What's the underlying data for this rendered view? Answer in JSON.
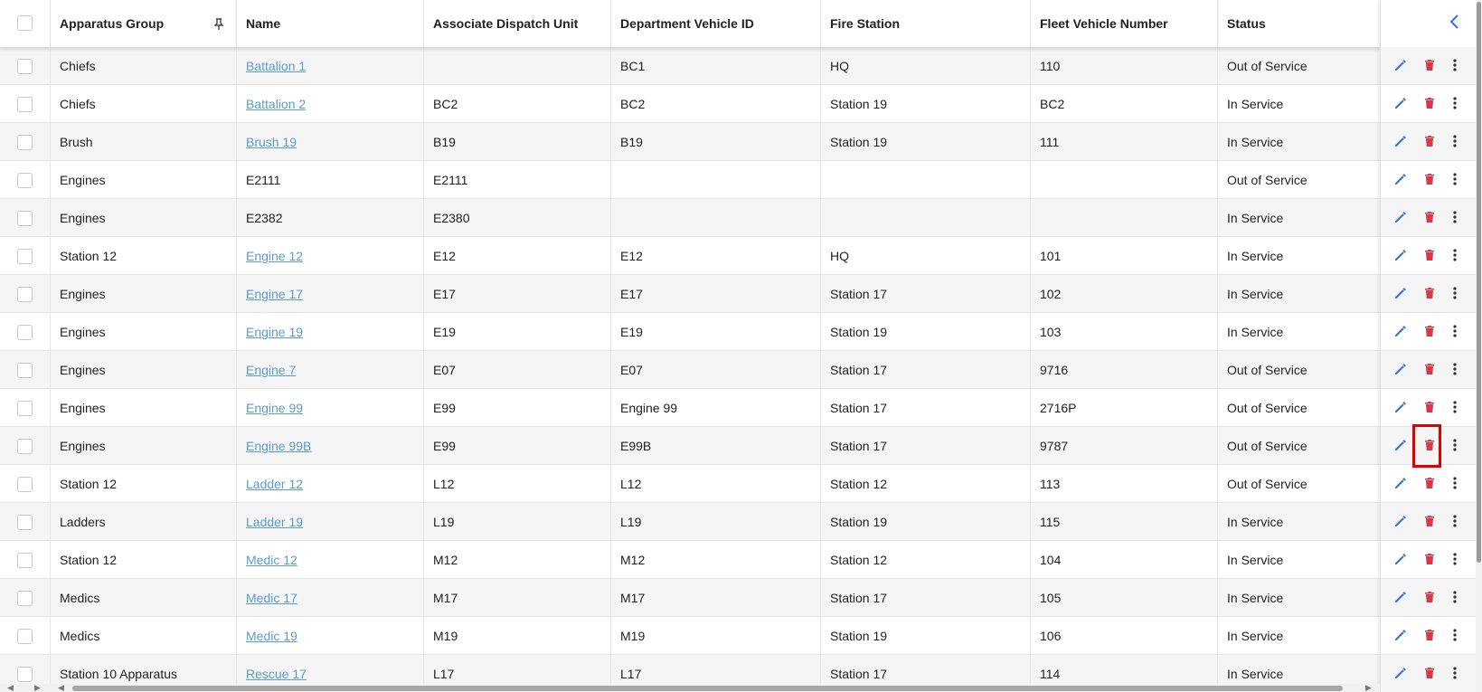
{
  "columns": [
    "Apparatus Group",
    "Name",
    "Associate Dispatch Unit",
    "Department Vehicle ID",
    "Fire Station",
    "Fleet Vehicle Number",
    "Status"
  ],
  "pin_icon": "pin-icon",
  "collapse_icon": "chevron-left-icon",
  "rows": [
    {
      "group": "Chiefs",
      "name": "Battalion 1",
      "link": true,
      "adu": "",
      "dvid": "BC1",
      "station": "HQ",
      "fleet": "110",
      "status": "Out of Service"
    },
    {
      "group": "Chiefs",
      "name": "Battalion 2",
      "link": true,
      "adu": "BC2",
      "dvid": "BC2",
      "station": "Station 19",
      "fleet": "BC2",
      "status": "In Service"
    },
    {
      "group": "Brush",
      "name": "Brush 19",
      "link": true,
      "adu": "B19",
      "dvid": "B19",
      "station": "Station 19",
      "fleet": "111",
      "status": "In Service"
    },
    {
      "group": "Engines",
      "name": "E2111",
      "link": false,
      "adu": "E2111",
      "dvid": "",
      "station": "",
      "fleet": "",
      "status": "Out of Service"
    },
    {
      "group": "Engines",
      "name": "E2382",
      "link": false,
      "adu": "E2380",
      "dvid": "",
      "station": "",
      "fleet": "",
      "status": "In Service"
    },
    {
      "group": "Station 12",
      "name": "Engine 12",
      "link": true,
      "adu": "E12",
      "dvid": "E12",
      "station": "HQ",
      "fleet": "101",
      "status": "In Service"
    },
    {
      "group": "Engines",
      "name": "Engine 17",
      "link": true,
      "adu": "E17",
      "dvid": "E17",
      "station": "Station 17",
      "fleet": "102",
      "status": "In Service"
    },
    {
      "group": "Engines",
      "name": "Engine 19",
      "link": true,
      "adu": "E19",
      "dvid": "E19",
      "station": "Station 19",
      "fleet": "103",
      "status": "In Service"
    },
    {
      "group": "Engines",
      "name": "Engine 7",
      "link": true,
      "adu": "E07",
      "dvid": "E07",
      "station": "Station 17",
      "fleet": "9716",
      "status": "Out of Service"
    },
    {
      "group": "Engines",
      "name": "Engine 99",
      "link": true,
      "adu": "E99",
      "dvid": "Engine 99",
      "station": "Station 17",
      "fleet": "2716P",
      "status": "Out of Service"
    },
    {
      "group": "Engines",
      "name": "Engine 99B",
      "link": true,
      "adu": "E99",
      "dvid": "E99B",
      "station": "Station 17",
      "fleet": "9787",
      "status": "Out of Service"
    },
    {
      "group": "Station 12",
      "name": "Ladder 12",
      "link": true,
      "adu": "L12",
      "dvid": "L12",
      "station": "Station 12",
      "fleet": "113",
      "status": "Out of Service"
    },
    {
      "group": "Ladders",
      "name": "Ladder 19",
      "link": true,
      "adu": "L19",
      "dvid": "L19",
      "station": "Station 19",
      "fleet": "115",
      "status": "In Service"
    },
    {
      "group": "Station 12",
      "name": "Medic 12",
      "link": true,
      "adu": "M12",
      "dvid": "M12",
      "station": "Station 12",
      "fleet": "104",
      "status": "In Service"
    },
    {
      "group": "Medics",
      "name": "Medic 17",
      "link": true,
      "adu": "M17",
      "dvid": "M17",
      "station": "Station 17",
      "fleet": "105",
      "status": "In Service"
    },
    {
      "group": "Medics",
      "name": "Medic 19",
      "link": true,
      "adu": "M19",
      "dvid": "M19",
      "station": "Station 19",
      "fleet": "106",
      "status": "In Service"
    },
    {
      "group": "Station 10 Apparatus",
      "name": "Rescue 17",
      "link": true,
      "adu": "L17",
      "dvid": "L17",
      "station": "Station 17",
      "fleet": "114",
      "status": "In Service"
    }
  ],
  "row_icons": {
    "edit": "pencil-icon",
    "delete": "trash-icon",
    "more": "more-vert-icon"
  },
  "colors": {
    "edit": "#3b6fd8",
    "delete": "#d63a4a",
    "more": "#333333",
    "link": "#5a9bd4",
    "highlight": "#e00000"
  },
  "highlighted_row": 10
}
